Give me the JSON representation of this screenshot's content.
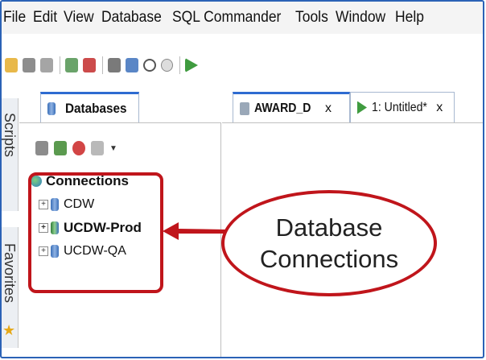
{
  "menu": [
    "File",
    "Edit",
    "View",
    "Database",
    "SQL Commander",
    "Tools",
    "Window",
    "Help"
  ],
  "side_tabs": {
    "scripts": "Scripts",
    "favorites": "Favorites"
  },
  "databases_tab": {
    "label": "Databases"
  },
  "tree": {
    "root": "Connections",
    "items": [
      {
        "label": "CDW",
        "bold": false
      },
      {
        "label": "UCDW-Prod",
        "bold": true
      },
      {
        "label": "UCDW-QA",
        "bold": false
      }
    ]
  },
  "editor_tabs": [
    {
      "label": "AWARD_D",
      "close": "x",
      "active": true
    },
    {
      "label": "1: Untitled*",
      "close": "x",
      "active": false
    }
  ],
  "callout": {
    "line1": "Database",
    "line2": "Connections"
  },
  "colors": {
    "accent": "#2e6bd1",
    "annotation": "#c0151b"
  }
}
